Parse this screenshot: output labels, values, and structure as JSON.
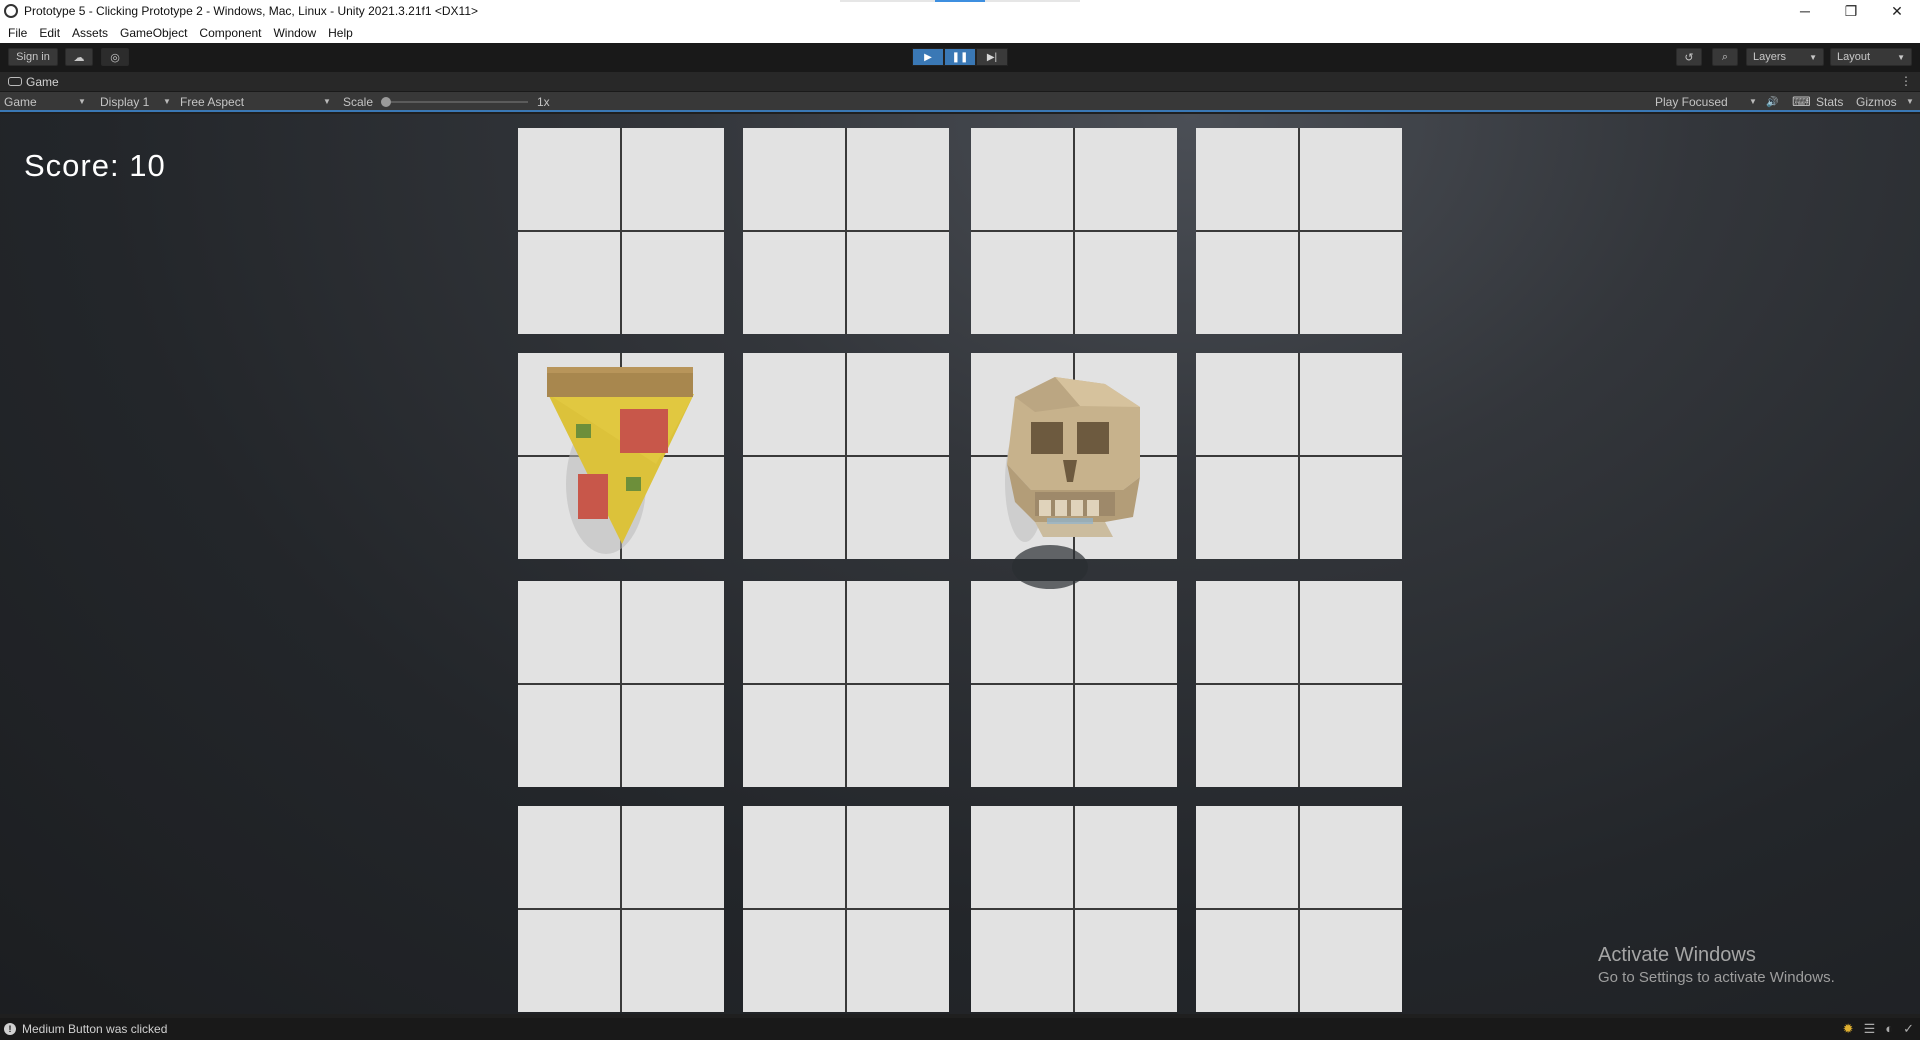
{
  "window": {
    "title": "Prototype 5 - Clicking Prototype 2 - Windows, Mac, Linux - Unity 2021.3.21f1 <DX11>",
    "minimize": "─",
    "restore": "❐",
    "close": "✕"
  },
  "menu": [
    "File",
    "Edit",
    "Assets",
    "GameObject",
    "Component",
    "Window",
    "Help"
  ],
  "toolbar": {
    "sign_in": "Sign in",
    "cloud_icon": "☁",
    "collab_icon": "◎",
    "play_icon": "▶",
    "pause_icon": "❚❚",
    "step_icon": "▶|",
    "history_icon": "↺",
    "search_icon": "⌕",
    "layers": "Layers",
    "layout": "Layout"
  },
  "panel": {
    "tab_label": "Game",
    "menu_icon": "⋮"
  },
  "gamebar": {
    "mode": "Game",
    "display": "Display 1",
    "aspect": "Free Aspect",
    "scale_label": "Scale",
    "scale_value": "1x",
    "play_mode": "Play Focused",
    "audio_icon": "🔊",
    "keyboard_icon": "⌨",
    "stats": "Stats",
    "gizmos": "Gizmos"
  },
  "game": {
    "score_text": "Score: 10",
    "objects": [
      "pizza",
      "skull"
    ]
  },
  "watermark": {
    "line1": "Activate Windows",
    "line2": "Go to Settings to activate Windows."
  },
  "status": {
    "message": "Medium Button was clicked",
    "info_icon": "!"
  },
  "colors": {
    "accent": "#3a78b5",
    "tile": "#e2e2e2",
    "tile_lines": "#3a3a3a"
  }
}
